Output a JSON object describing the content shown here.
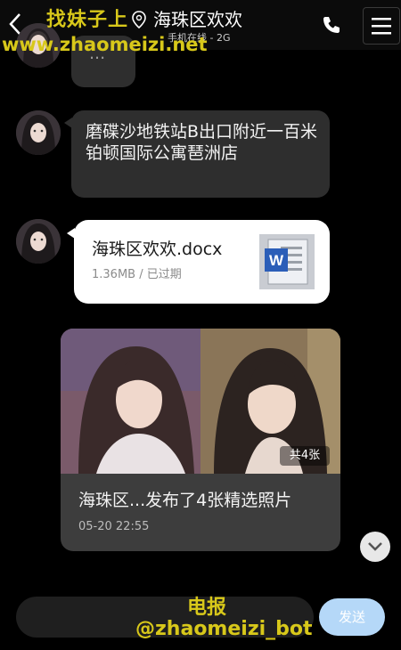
{
  "header": {
    "title": "海珠区欢欢",
    "subtitle": "手机在线 - 2G",
    "back_icon": "chevron-left-icon",
    "location_icon": "location-pin-icon",
    "call_icon": "phone-icon",
    "menu_icon": "hamburger-menu-icon"
  },
  "watermark": {
    "top_line1": "找妹子上",
    "top_line2": "www.zhaomeizi.net",
    "bottom_line1": "电报",
    "bottom_line2": "@zhaomeizi_bot"
  },
  "messages": {
    "partial_text": "...",
    "location_text": "磨碟沙地铁站B出口附近一百米\n铂顿国际公寓琶洲店"
  },
  "file": {
    "name": "海珠区欢欢.docx",
    "meta": "1.36MB / 已过期",
    "icon": "word-document-icon"
  },
  "album": {
    "badge": "共4张",
    "caption": "海珠区...发布了4张精选照片",
    "time": "05-20 22:55"
  },
  "input": {
    "send_label": "发送"
  },
  "colors": {
    "watermark": "#d8c81a",
    "send_button": "#b5d8f8",
    "bubble": "#2e2e2e"
  }
}
